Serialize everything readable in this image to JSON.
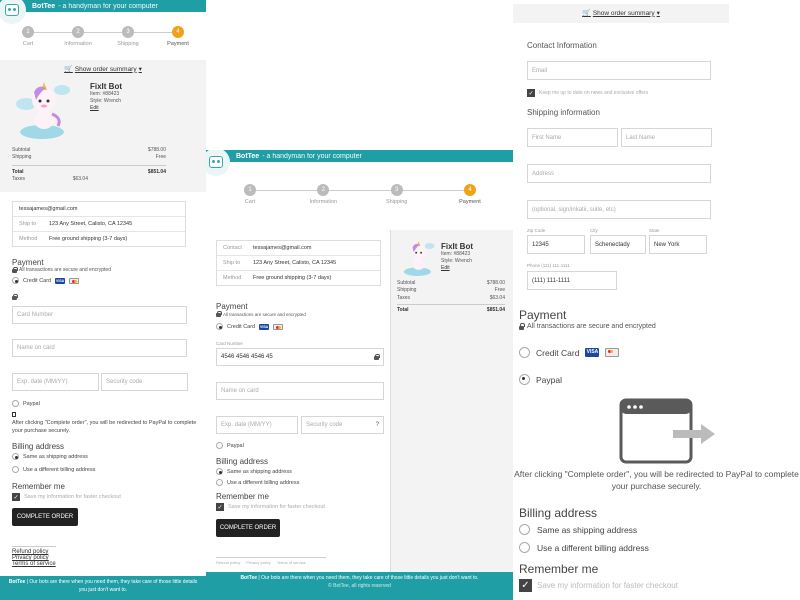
{
  "brand": {
    "name": "BotTee",
    "tagline": "- a handyman for your computer",
    "tagline2": "a handyman for your computer"
  },
  "steps": [
    {
      "num": "1",
      "label": "Cart"
    },
    {
      "num": "2",
      "label": "Information"
    },
    {
      "num": "3",
      "label": "Shipping"
    },
    {
      "num": "4",
      "label": "Payment"
    }
  ],
  "summary_toggle": "Show order summary",
  "product": {
    "name": "FixIt Bot",
    "item": "Item: #88423",
    "style": "Style: Wrench",
    "edit": "Edit"
  },
  "totals": {
    "subtotal_label": "Subtotal",
    "subtotal": "$788.00",
    "shipping_label": "Shipping",
    "shipping": "Free",
    "taxes_label": "Taxes",
    "taxes": "$63.04",
    "total_label": "Total",
    "total": "$851.04"
  },
  "info": {
    "contact_label": "Contact",
    "contact": "tessajames@gmail.com",
    "ship_label": "Ship to",
    "ship": "123 Any Street, Calisto, CA 12345",
    "method_label": "Method",
    "method": "Free ground shipping (3-7 days)"
  },
  "payment": {
    "title": "Payment",
    "secure": "All transactions are secure and encrypted",
    "credit_card": "Credit Card",
    "paypal": "Paypal",
    "card_number_placeholder": "Card Number",
    "card_number_label": "Card Number",
    "card_number_value": "4546 4546 4546 45",
    "name_placeholder": "Name on card",
    "exp_placeholder": "Exp. date (MM/YY)",
    "security_placeholder": "Security code",
    "paypal_note": "After clicking \"Complete order\", you will be redirected to PayPal to complete your purchase securely."
  },
  "billing": {
    "title": "Billing address",
    "same": "Same as shipping address",
    "different": "Use a different billing address"
  },
  "remember": {
    "title": "Remember me",
    "save": "Save my information for faster checkout"
  },
  "complete_button": "COMPLETE ORDER",
  "links": {
    "refund": "Refund policy",
    "privacy": "Privacy policy",
    "terms": "Terms of service"
  },
  "footer": {
    "text": "| Our bots are there when you need them, they take care of those little details you just don't want to.",
    "copyright": "© BotTee, all rights reserved"
  },
  "contact_form": {
    "contact_title": "Contact Information",
    "email_placeholder": "Email",
    "news": "Keep me up to date on news and exclusive offers",
    "shipping_title": "Shipping information",
    "first": "First Name",
    "last": "Last Name",
    "address": "Address",
    "apt": "(optional, sign/inkatii, suite, etc)",
    "zip_label": "Zip Code",
    "zip": "12345",
    "city_label": "City",
    "city": "Schenectady",
    "state_label": "State",
    "state": "New York",
    "phone_label": "Phone (111) 111-1111",
    "phone": "(111) 111-1111"
  }
}
